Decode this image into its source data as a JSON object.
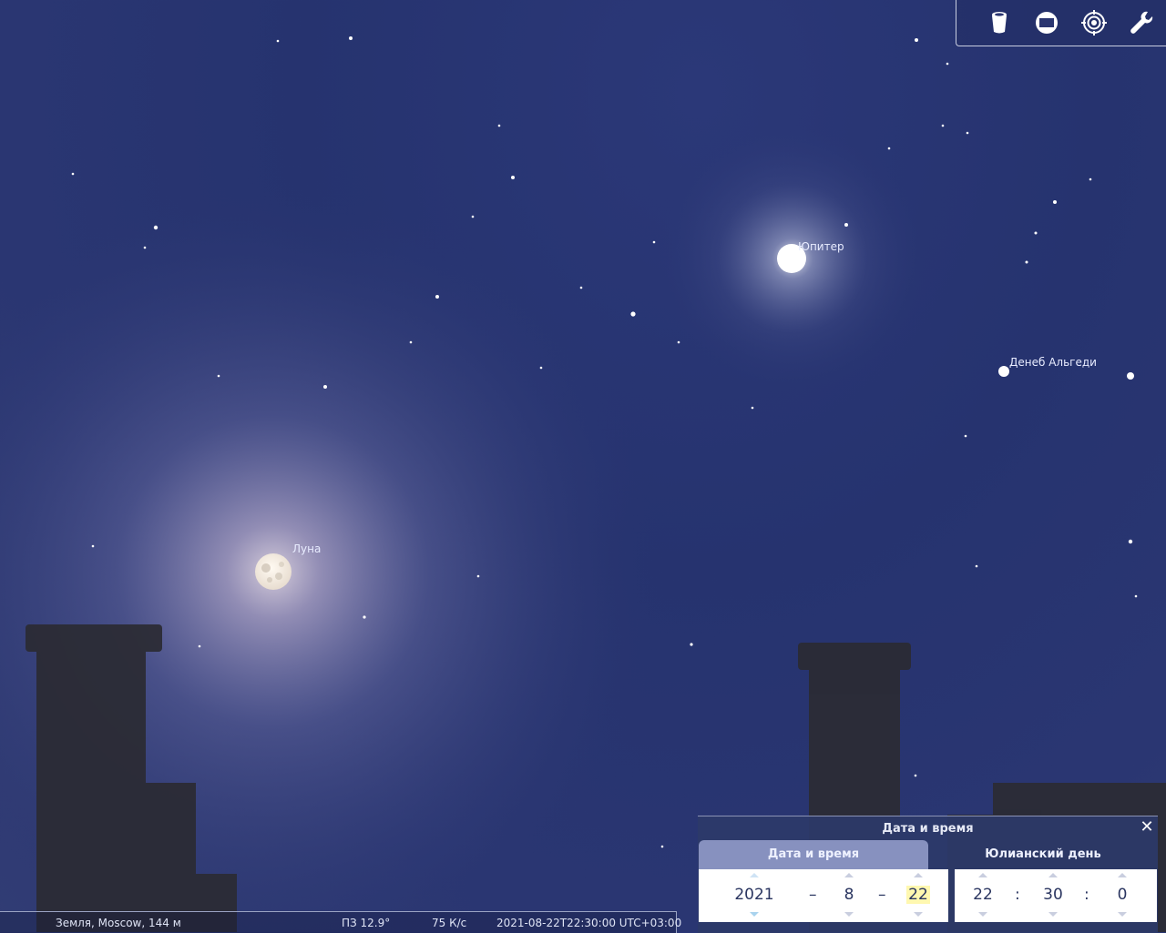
{
  "sky": {
    "labels": {
      "moon": "Луна",
      "jupiter": "Юпитер",
      "deneb_algedi": "Денеб Альгеди"
    }
  },
  "toolbar": {
    "buttons": [
      {
        "icon": "trash-bin-icon"
      },
      {
        "icon": "screen-window-icon"
      },
      {
        "icon": "target-icon"
      },
      {
        "icon": "wrench-icon"
      }
    ]
  },
  "status": {
    "location": "Земля, Moscow, 144 м",
    "fov": "ПЗ 12.9°",
    "fps": "75 К/с",
    "datetime": "2021-08-22Т22:30:00 UTC+03:00"
  },
  "datetime_window": {
    "title": "Дата и время",
    "tabs": [
      "Дата и время",
      "Юлианский день"
    ],
    "date": {
      "year": "2021",
      "month": "8",
      "day": "22",
      "sep": "–"
    },
    "time": {
      "hour": "22",
      "minute": "30",
      "second": "0",
      "sep": ":"
    },
    "close_icon": "close-icon"
  },
  "colors": {
    "sky": "#27346f",
    "panel": "#2d3969",
    "tab_active": "#8791bf",
    "text": "#2a3560"
  }
}
